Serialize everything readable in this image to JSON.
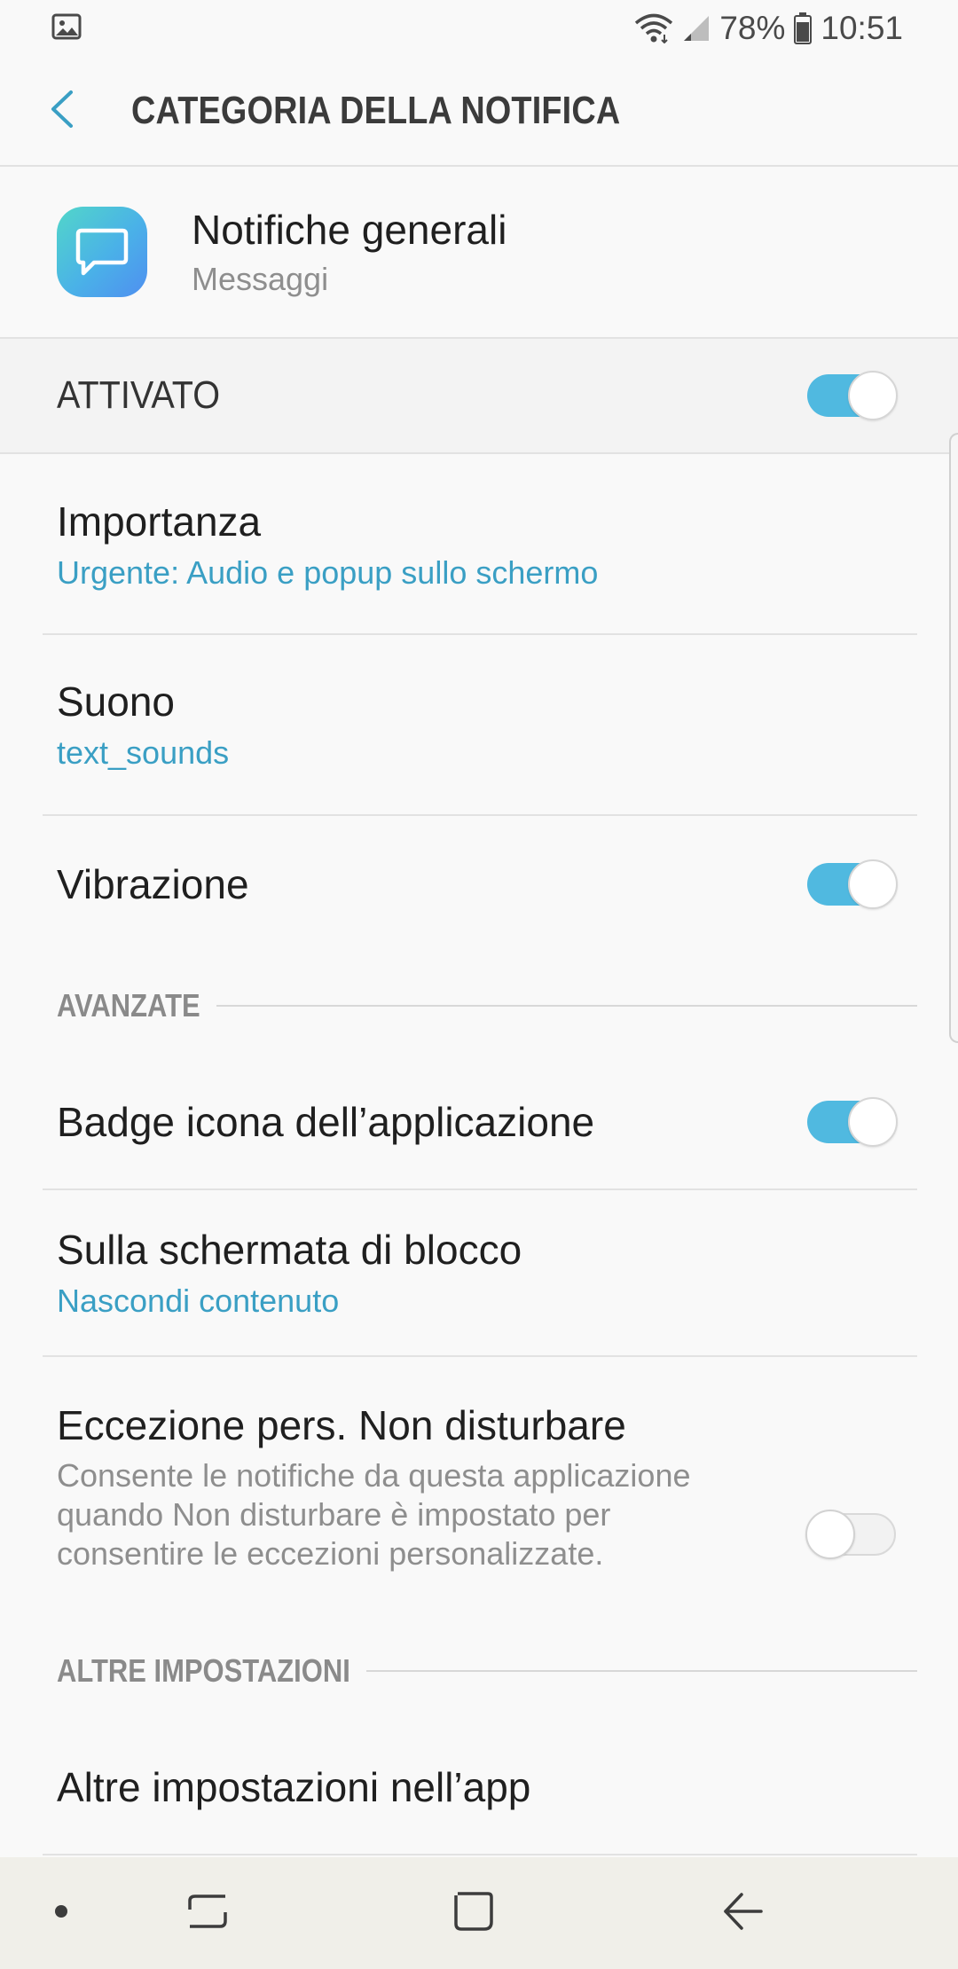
{
  "status_bar": {
    "left_icon": "image-notification-icon",
    "battery_percent": "78%",
    "time": "10:51",
    "icons": [
      "wifi-icon",
      "signal-icon",
      "battery-icon"
    ]
  },
  "app_bar": {
    "back_icon": "chevron-left-icon",
    "title": "CATEGORIA DELLA NOTIFICA"
  },
  "app_header": {
    "icon": "messages-app-icon",
    "title": "Notifiche generali",
    "subtitle": "Messaggi"
  },
  "master_switch": {
    "label": "ATTIVATO",
    "on": true
  },
  "settings": {
    "importance": {
      "title": "Importanza",
      "value": "Urgente: Audio e popup sullo schermo"
    },
    "sound": {
      "title": "Suono",
      "value": "text_sounds"
    },
    "vibration": {
      "title": "Vibrazione",
      "on": true
    }
  },
  "advanced": {
    "header": "AVANZATE",
    "badge": {
      "title": "Badge icona dell’applicazione",
      "on": true
    },
    "lock_screen": {
      "title": "Sulla schermata di blocco",
      "value": "Nascondi contenuto"
    },
    "dnd": {
      "title": "Eccezione pers. Non disturbare",
      "description": "Consente le notifiche da questa applicazione quando Non disturbare è impostato per consentire le eccezioni personalizzate.",
      "on": false
    }
  },
  "other": {
    "header": "ALTRE IMPOSTAZIONI",
    "in_app": {
      "title": "Altre impostazioni nell’app"
    }
  },
  "nav_bar": {
    "buttons": [
      "dot-icon",
      "recents-icon",
      "home-icon",
      "back-arrow-icon"
    ]
  },
  "colors": {
    "accent": "#50b9e0",
    "link": "#3a9fc4",
    "background": "#f9f9f9",
    "nav_background": "#f0efe9"
  }
}
